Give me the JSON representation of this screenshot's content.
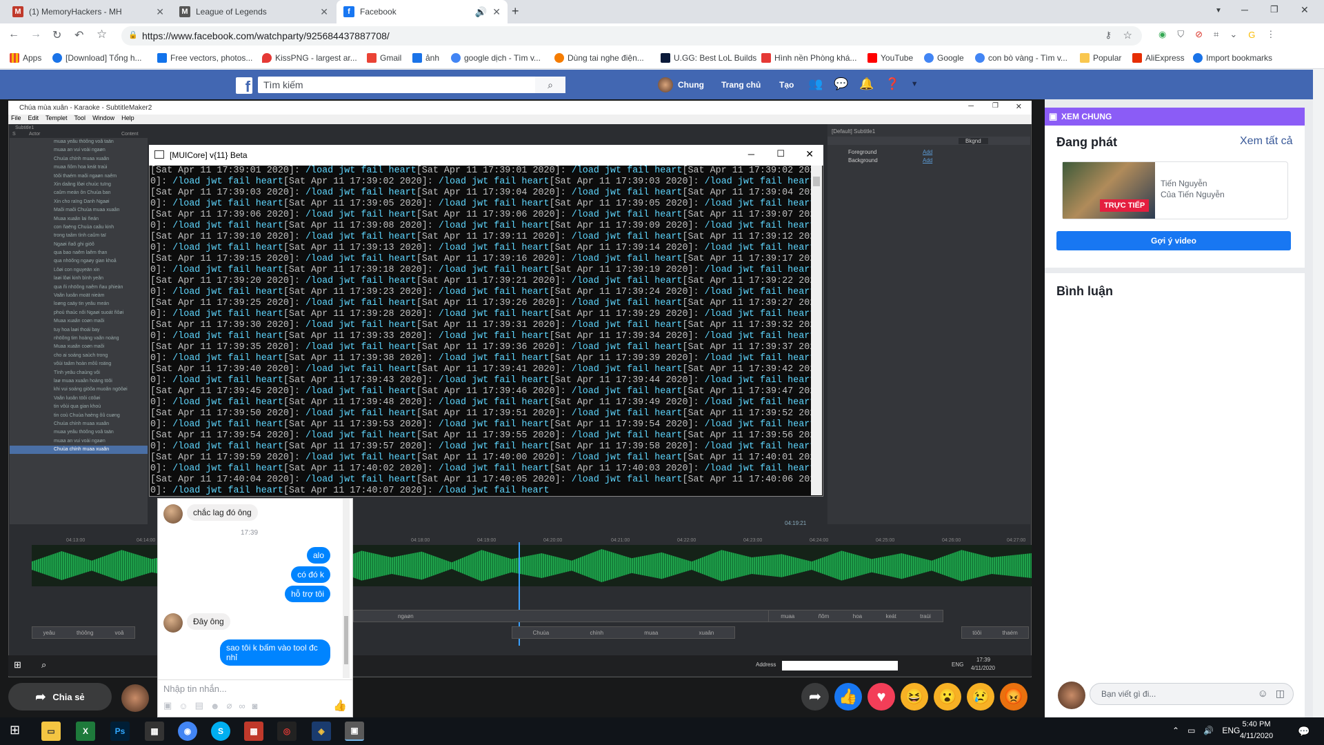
{
  "browser": {
    "tabs": [
      {
        "title": "(1) MemoryHackers - MH"
      },
      {
        "title": "League of Legends"
      },
      {
        "title": "Facebook"
      }
    ],
    "url": "https://www.facebook.com/watchparty/925684437887708/",
    "bookmarks": [
      "Apps",
      "[Download] Tổng h...",
      "Free vectors, photos...",
      "KissPNG - largest ar...",
      "Gmail",
      "ảnh",
      "google dịch - Tìm v...",
      "Dùng tai nghe điện...",
      "U.GG: Best LoL Builds",
      "Hình nền Phòng khá...",
      "YouTube",
      "Google",
      "con bò vàng - Tìm v...",
      "Popular",
      "AliExpress",
      "Import bookmarks"
    ]
  },
  "facebook": {
    "search_placeholder": "Tìm kiếm",
    "profile_name": "Chung",
    "nav_home": "Trang chủ",
    "nav_create": "Tạo"
  },
  "subtitle_maker": {
    "title": "Chúa mùa xuân - Karaoke - SubtitleMaker2",
    "menu": [
      "File",
      "Edit",
      "Templet",
      "Tool",
      "Window",
      "Help"
    ],
    "tab_label": "Subtitle1",
    "col_s": "S",
    "col_actor": "Actor",
    "col_content": "Content",
    "lines": [
      "muaa yeâu thöông voâ taän",
      "muaa an vui voài ngaøn",
      "Chuùa chính muaa xuaân",
      "muaa ñôm hoa keát traùi",
      "töôi thaém maõi ngaøn naêm",
      "Xin daâng lôøi chuùc tuïng",
      "caûm meán ôn Chuùa ban",
      "Xin cho raïng Danh Ngaøi",
      "Maõi maõi Chuùa muaa xuaân",
      "Muaa xuaân lai ñeán",
      "con ñaëng Chuùa caâu kinh",
      "trong taâm tình caûm taï",
      "Ngaøi ñaõ ghi giöõ",
      "qua bao naêm laêm than",
      "qua nhöõng ngaøy gian khoå",
      "Lôøi con nguyeän xin",
      "laøi lôøi kinh bình yeân",
      "qua ñi nhöõng naêm ñau phieàn",
      "Vaãn luoân moät nieàm",
      "loøng caäy tin yeâu meán",
      "phoù thaùc nôi Ngaøi suoát ñôøi",
      "Muaa xuaân coøn maõi",
      "tuy hoa laøi thoái bay",
      "nhöõng tim hoàng vaãn noàng",
      "Muaa xuaân coøn maõi",
      "cho ai soáng saùch trong",
      "vôùi taâm hoàn môû roäng",
      "Tình yeâu chaùng vôi",
      "laø muaa xuaân hoàng töôi",
      "khi vui soáng giöõa muoân ngöôøi",
      "Vaãn luoân töôi cöôøi",
      "tin vôùi qua gian khoù",
      "tin coù Chuùa haèng ôû cuøng",
      "Chuùa chính muaa xuaân",
      "muaa yeâu thöông voâ taän",
      "muaa an vui voài ngaøn",
      "Chuùa chính muaa xuaân"
    ],
    "right_header": "[Default] Subtitle1",
    "right_tab": "Bkgnd",
    "foreground": "Foreground",
    "background": "Background",
    "add": "Add",
    "time_marker": "04:19:21",
    "ticks": [
      "04:13:00",
      "04:14:00",
      "04:18:00",
      "04:19:00",
      "04:20:00",
      "04:21:00",
      "04:22:00",
      "04:23:00",
      "04:24:00",
      "04:25:00",
      "04:26:00",
      "04:27:00"
    ],
    "track1": [
      "ngaøn",
      "muaa",
      "ñôm",
      "hoa",
      "keát",
      "traùi"
    ],
    "track2a": [
      "yeâu",
      "thöông",
      "voâ"
    ],
    "track2b": [
      "Chuùa",
      "chính",
      "muaa",
      "xuaân"
    ],
    "track2c": [
      "töôi",
      "thaém"
    ],
    "address_label": "Address",
    "lang": "ENG",
    "sys_time": "17:39",
    "sys_date": "4/11/2020"
  },
  "console": {
    "title": "[MUICore] v{11} Beta",
    "lines": [
      "[Sat Apr 11 17:39:01 2020]: |/load jwt fail heart|[Sat Apr 11 17:39:01 2020]: |/load jwt fail heart|[Sat Apr 11 17:39:02 202",
      "0]: |/load jwt fail heart|[Sat Apr 11 17:39:02 2020]: |/load jwt fail heart|[Sat Apr 11 17:39:03 2020]: |/load jwt fail heart",
      "[Sat Apr 11 17:39:03 2020]: |/load jwt fail heart|[Sat Apr 11 17:39:04 2020]: |/load jwt fail heart|[Sat Apr 11 17:39:04 202",
      "0]: |/load jwt fail heart|[Sat Apr 11 17:39:05 2020]: |/load jwt fail heart|[Sat Apr 11 17:39:05 2020]: |/load jwt fail heart",
      "[Sat Apr 11 17:39:06 2020]: |/load jwt fail heart|[Sat Apr 11 17:39:06 2020]: |/load jwt fail heart|[Sat Apr 11 17:39:07 202",
      "0]: |/load jwt fail heart|[Sat Apr 11 17:39:08 2020]: |/load jwt fail heart|[Sat Apr 11 17:39:09 2020]: |/load jwt fail heart",
      "[Sat Apr 11 17:39:10 2020]: |/load jwt fail heart|[Sat Apr 11 17:39:11 2020]: |/load jwt fail heart|[Sat Apr 11 17:39:12 202",
      "0]: |/load jwt fail heart|[Sat Apr 11 17:39:13 2020]: |/load jwt fail heart|[Sat Apr 11 17:39:14 2020]: |/load jwt fail heart",
      "[Sat Apr 11 17:39:15 2020]: |/load jwt fail heart|[Sat Apr 11 17:39:16 2020]: |/load jwt fail heart|[Sat Apr 11 17:39:17 202",
      "0]: |/load jwt fail heart|[Sat Apr 11 17:39:18 2020]: |/load jwt fail heart|[Sat Apr 11 17:39:19 2020]: |/load jwt fail heart",
      "[Sat Apr 11 17:39:20 2020]: |/load jwt fail heart|[Sat Apr 11 17:39:21 2020]: |/load jwt fail heart|[Sat Apr 11 17:39:22 202",
      "0]: |/load jwt fail heart|[Sat Apr 11 17:39:23 2020]: |/load jwt fail heart|[Sat Apr 11 17:39:24 2020]: |/load jwt fail heart",
      "[Sat Apr 11 17:39:25 2020]: |/load jwt fail heart|[Sat Apr 11 17:39:26 2020]: |/load jwt fail heart|[Sat Apr 11 17:39:27 202",
      "0]: |/load jwt fail heart|[Sat Apr 11 17:39:28 2020]: |/load jwt fail heart|[Sat Apr 11 17:39:29 2020]: |/load jwt fail heart",
      "[Sat Apr 11 17:39:30 2020]: |/load jwt fail heart|[Sat Apr 11 17:39:31 2020]: |/load jwt fail heart|[Sat Apr 11 17:39:32 202",
      "0]: |/load jwt fail heart|[Sat Apr 11 17:39:33 2020]: |/load jwt fail heart|[Sat Apr 11 17:39:34 2020]: |/load jwt fail heart",
      "[Sat Apr 11 17:39:35 2020]: |/load jwt fail heart|[Sat Apr 11 17:39:36 2020]: |/load jwt fail heart|[Sat Apr 11 17:39:37 202",
      "0]: |/load jwt fail heart|[Sat Apr 11 17:39:38 2020]: |/load jwt fail heart|[Sat Apr 11 17:39:39 2020]: |/load jwt fail heart",
      "[Sat Apr 11 17:39:40 2020]: |/load jwt fail heart|[Sat Apr 11 17:39:41 2020]: |/load jwt fail heart|[Sat Apr 11 17:39:42 202",
      "0]: |/load jwt fail heart|[Sat Apr 11 17:39:43 2020]: |/load jwt fail heart|[Sat Apr 11 17:39:44 2020]: |/load jwt fail heart",
      "[Sat Apr 11 17:39:45 2020]: |/load jwt fail heart|[Sat Apr 11 17:39:46 2020]: |/load jwt fail heart|[Sat Apr 11 17:39:47 202",
      "0]: |/load jwt fail heart|[Sat Apr 11 17:39:48 2020]: |/load jwt fail heart|[Sat Apr 11 17:39:49 2020]: |/load jwt fail heart",
      "[Sat Apr 11 17:39:50 2020]: |/load jwt fail heart|[Sat Apr 11 17:39:51 2020]: |/load jwt fail heart|[Sat Apr 11 17:39:52 202",
      "0]: |/load jwt fail heart|[Sat Apr 11 17:39:53 2020]: |/load jwt fail heart|[Sat Apr 11 17:39:54 2020]: |/load jwt fail heart",
      "[Sat Apr 11 17:39:54 2020]: |/load jwt fail heart|[Sat Apr 11 17:39:55 2020]: |/load jwt fail heart|[Sat Apr 11 17:39:56 202",
      "0]: |/load jwt fail heart|[Sat Apr 11 17:39:57 2020]: |/load jwt fail heart|[Sat Apr 11 17:39:58 2020]: |/load jwt fail heart",
      "[Sat Apr 11 17:39:59 2020]: |/load jwt fail heart|[Sat Apr 11 17:40:00 2020]: |/load jwt fail heart|[Sat Apr 11 17:40:01 202",
      "0]: |/load jwt fail heart|[Sat Apr 11 17:40:02 2020]: |/load jwt fail heart|[Sat Apr 11 17:40:03 2020]: |/load jwt fail heart",
      "[Sat Apr 11 17:40:04 2020]: |/load jwt fail heart|[Sat Apr 11 17:40:05 2020]: |/load jwt fail heart|[Sat Apr 11 17:40:06 202",
      "0]: |/load jwt fail heart|[Sat Apr 11 17:40:07 2020]: |/load jwt fail heart|"
    ]
  },
  "chat": {
    "msg1": "chắc lag đó ông",
    "time": "17:39",
    "msg2": "alo",
    "msg3": "có đó k",
    "msg4": "hỗ trợ tôi",
    "msg5": "Đây ông",
    "msg6": "sao tôi k bấm vào tool đc nhỉ",
    "input_placeholder": "Nhập tin nhắn..."
  },
  "share_label": "Chia sẻ",
  "right_panel": {
    "watch_together": "XEM CHUNG",
    "now_playing": "Đang phát",
    "see_all": "Xem tất cả",
    "live_badge": "TRỰC TIẾP",
    "video_owner": "Tiến Nguyễn",
    "video_sub": "Của Tiến Nguyễn",
    "suggest_button": "Gợi ý video",
    "comments_title": "Bình luận",
    "comment_placeholder": "Bạn viết gì đi..."
  },
  "taskbar": {
    "lang": "ENG",
    "time": "5:40 PM",
    "date": "4/11/2020"
  },
  "colors": {
    "facebook_blue": "#4267b2",
    "messenger_blue": "#0084ff",
    "watch_purple": "#8b5cf6",
    "console_cyan": "#5fd7ff"
  }
}
